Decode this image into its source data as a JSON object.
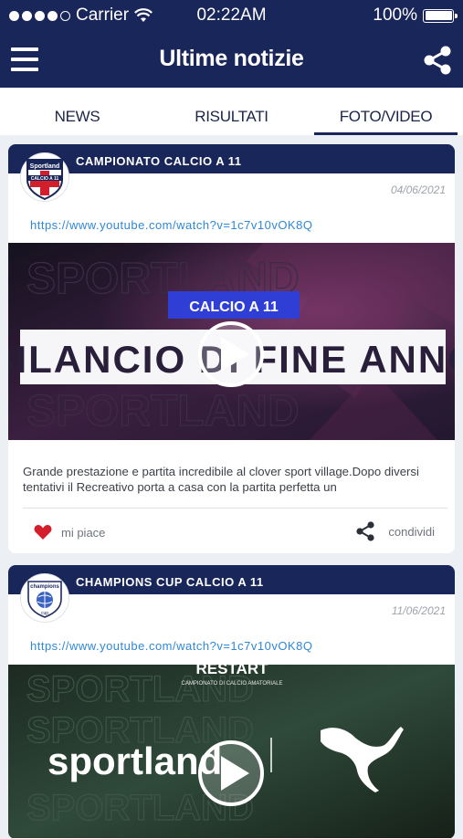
{
  "status_bar": {
    "carrier": "Carrier",
    "time": "02:22AM",
    "battery": "100%"
  },
  "nav": {
    "title": "Ultime notizie"
  },
  "tabs": [
    {
      "label": "NEWS",
      "active": false
    },
    {
      "label": "RISULTATI",
      "active": false
    },
    {
      "label": "FOTO/VIDEO",
      "active": true
    }
  ],
  "posts": [
    {
      "competition": "CAMPIONATO CALCIO A 11",
      "logo_text": "Sportland",
      "logo_sub": "CALCIO A 11",
      "date": "04/06/2021",
      "url": "https://www.youtube.com/watch?v=1c7v10vOK8Q",
      "video_badge": "CALCIO A 11",
      "video_title": "BILANCIO DI FINE ANNO",
      "video_watermark": "SPORTLAND",
      "description": "Grande prestazione e partita incredibile al clover sport village.Dopo diversi tentativi il Recreativo porta a casa con la partita perfetta un",
      "like_label": "mi piace",
      "share_label": "condividi"
    },
    {
      "competition": "CHAMPIONS CUP CALCIO A 11",
      "logo_text": "champions",
      "logo_sub": "cup",
      "date": "11/06/2021",
      "url": "https://www.youtube.com/watch?v=1c7v10vOK8Q",
      "video_top": "RESTART",
      "video_top_sub": "CAMPIONATO DI CALCIO AMATORIALE",
      "video_brand": "sportland",
      "video_watermark": "SPORTLAND"
    }
  ],
  "colors": {
    "primary": "#192659",
    "link": "#2f88d7",
    "like": "#d21f2b",
    "badge": "#2f3fd6"
  }
}
